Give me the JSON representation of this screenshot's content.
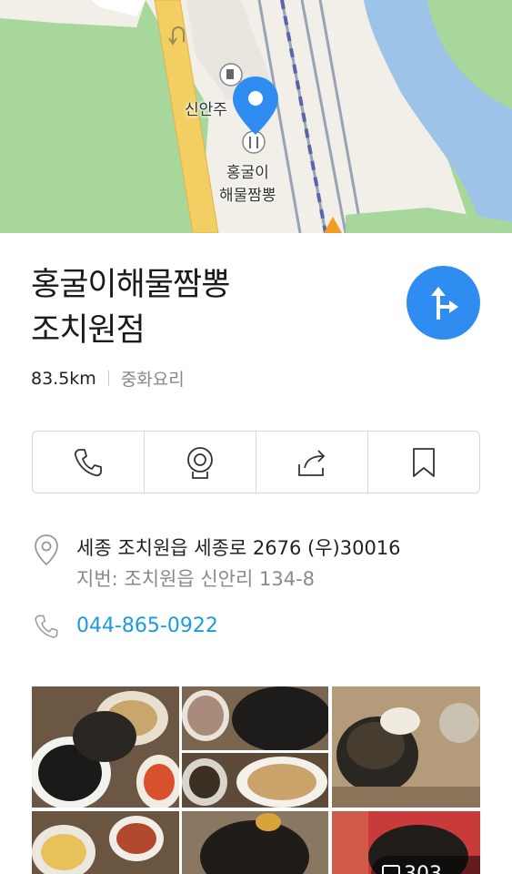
{
  "map": {
    "station_label": "신안주",
    "place_label_line1": "홍굴이",
    "place_label_line2": "해물짬뽕"
  },
  "place": {
    "name_line1": "홍굴이해물짬뽕",
    "name_line2": "조치원점",
    "distance": "83.5km",
    "category": "중화요리"
  },
  "actions": [
    {
      "icon": "phone-icon"
    },
    {
      "icon": "roadview-icon"
    },
    {
      "icon": "share-icon"
    },
    {
      "icon": "bookmark-icon"
    }
  ],
  "address": {
    "road": "세종 조치원읍 세종로 2676 (우)30016",
    "lot": "지번: 조치원읍 신안리 134-8"
  },
  "phone": "044-865-0922",
  "photos": {
    "count_text": "303"
  },
  "colors": {
    "accent_blue": "#2f8cf1",
    "phone_blue": "#1a9be0",
    "map_green": "#a8d79b",
    "road_yellow": "#f3cf63"
  }
}
